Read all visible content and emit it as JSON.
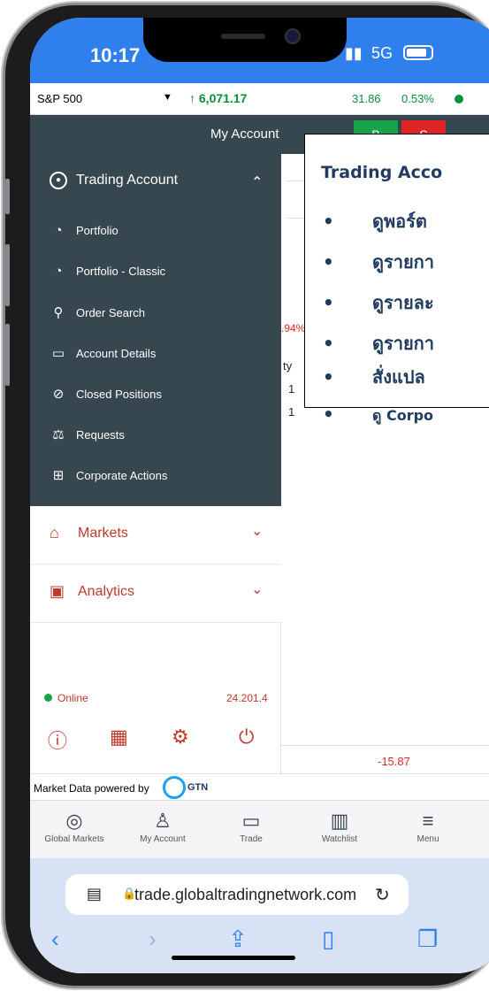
{
  "status_bar": {
    "time": "10:17",
    "network": "5G"
  },
  "ticker": {
    "symbol": "S&P 500",
    "price": "6,071.17",
    "change": "31.86",
    "change_pct": "0.53%"
  },
  "header": {
    "title": "My Account",
    "buy_label": "B",
    "sell_label": "S"
  },
  "menu": {
    "trading_account": {
      "label": "Trading Account",
      "items": [
        {
          "label": "Portfolio",
          "icon": "portfolio-icon"
        },
        {
          "label": "Portfolio - Classic",
          "icon": "portfolio-classic-icon"
        },
        {
          "label": "Order Search",
          "icon": "search-icon"
        },
        {
          "label": "Account Details",
          "icon": "account-details-icon"
        },
        {
          "label": "Closed Positions",
          "icon": "closed-positions-icon"
        },
        {
          "label": "Requests",
          "icon": "requests-icon"
        },
        {
          "label": "Corporate Actions",
          "icon": "corporate-actions-icon"
        }
      ]
    },
    "markets_label": "Markets",
    "analytics_label": "Analytics",
    "online_label": "Online",
    "version": "24.201.4"
  },
  "background": {
    "pct_fragment": ".94%",
    "col_fragment": "ty",
    "val1": "1",
    "val2": "1",
    "neg_value": "-15.87"
  },
  "powered_by": {
    "text": "Market Data powered by",
    "brand": "GTN"
  },
  "bottom_nav": [
    {
      "label": "Global Markets",
      "icon": "globe-icon"
    },
    {
      "label": "My Account",
      "icon": "user-icon"
    },
    {
      "label": "Trade",
      "icon": "wallet-icon"
    },
    {
      "label": "Watchlist",
      "icon": "watchlist-icon"
    },
    {
      "label": "Menu",
      "icon": "hamburger-icon"
    }
  ],
  "browser": {
    "url": "trade.globaltradingnetwork.com"
  },
  "callout": {
    "title": "Trading Acco",
    "bullets": [
      "ดูพอร์ต",
      "ดูรายกา",
      "ดูรายละ",
      "ดูรายกา",
      "สั่งแปล",
      "ดู Corpo"
    ]
  },
  "colors": {
    "status_blue": "#2f80ed",
    "header_dark": "#37474f",
    "accent_red": "#c0392b",
    "up_green": "#0a8f3c"
  }
}
